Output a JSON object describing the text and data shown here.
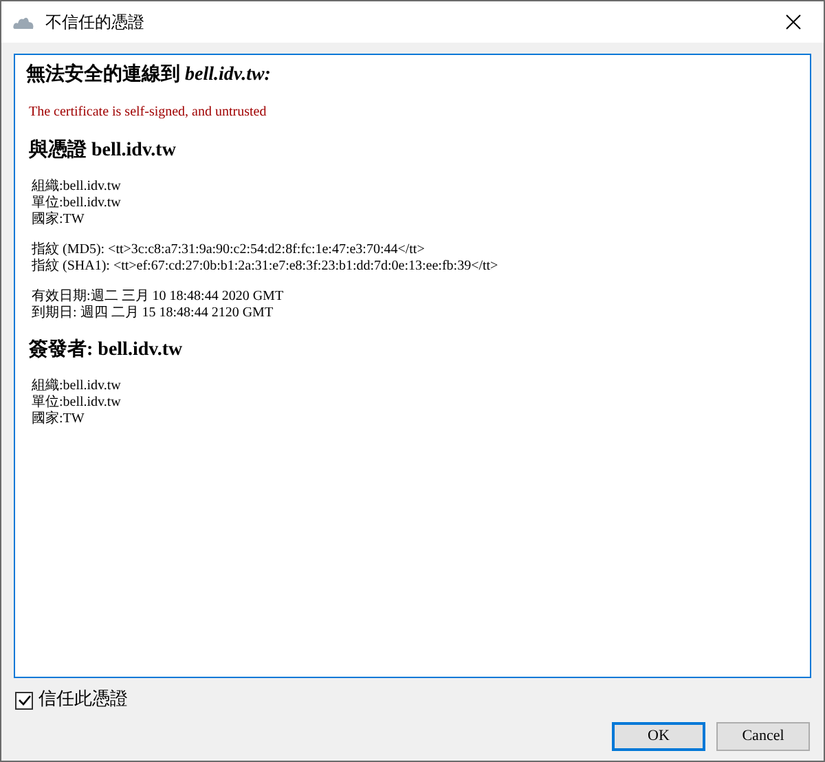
{
  "window": {
    "title": "不信任的憑證"
  },
  "content": {
    "heading": "無法安全的連線到 *bell.idv.tw:*",
    "error": "The certificate is self-signed, and untrusted",
    "sections": [
      {
        "heading": "與憑證 bell.idv.tw",
        "groups": [
          [
            "組織:bell.idv.tw",
            "單位:bell.idv.tw",
            "國家:TW"
          ],
          [
            "指紋 (MD5): <tt>3c:c8:a7:31:9a:90:c2:54:d2:8f:fc:1e:47:e3:70:44</tt>",
            "指紋 (SHA1): <tt>ef:67:cd:27:0b:b1:2a:31:e7:e8:3f:23:b1:dd:7d:0e:13:ee:fb:39</tt>"
          ],
          [
            "有效日期:週二 三月 10 18:48:44 2020 GMT",
            "到期日: 週四 二月 15 18:48:44 2120 GMT"
          ]
        ]
      },
      {
        "heading": "簽發者: bell.idv.tw",
        "groups": [
          [
            "組織:bell.idv.tw",
            "單位:bell.idv.tw",
            "國家:TW"
          ]
        ]
      }
    ]
  },
  "trust_checkbox": {
    "label": "信任此憑證",
    "checked": true
  },
  "buttons": [
    {
      "label": "OK",
      "default": true
    },
    {
      "label": "Cancel",
      "default": false
    }
  ]
}
